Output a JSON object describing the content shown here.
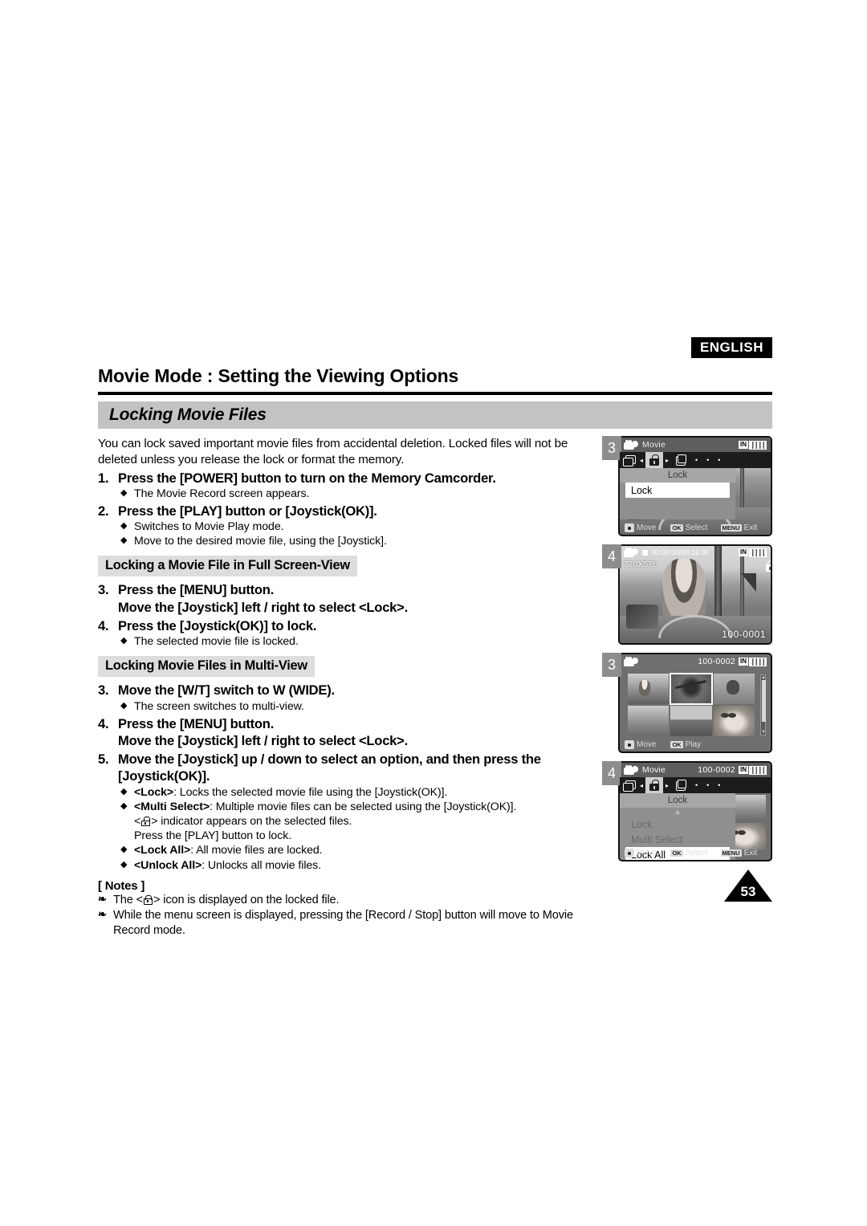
{
  "header": {
    "language_badge": "ENGLISH",
    "chapter_title": "Movie Mode : Setting the Viewing Options",
    "section_title": "Locking Movie Files"
  },
  "body": {
    "intro": "You can lock saved important movie files from accidental deletion. Locked files will not be deleted unless you release the lock or format the memory.",
    "step1_num": "1.",
    "step1_text": "Press the [POWER] button to turn on the Memory Camcorder.",
    "step1_bullet1": "The Movie Record screen appears.",
    "step2_num": "2.",
    "step2_text": "Press the [PLAY] button or [Joystick(OK)].",
    "step2_bullet1": "Switches to Movie Play mode.",
    "step2_bullet2": "Move to the desired movie file, using the [Joystick].",
    "subhead_full": "Locking a Movie File in Full Screen-View",
    "step3_num": "3.",
    "step3_text": "Press the [MENU] button.",
    "step3_text_line2": "Move the [Joystick] left / right to select <Lock>.",
    "step4_num": "4.",
    "step4_text": "Press the [Joystick(OK)] to lock.",
    "step4_bullet1": "The selected movie file is locked.",
    "subhead_multi": "Locking Movie Files in Multi-View",
    "m_step3_num": "3.",
    "m_step3_text": "Move the [W/T] switch to W (WIDE).",
    "m_step3_bullet1": "The screen switches to multi-view.",
    "m_step4_num": "4.",
    "m_step4_text": "Press the [MENU] button.",
    "m_step4_text_line2": "Move the [Joystick] left / right to select <Lock>.",
    "m_step5_num": "5.",
    "m_step5_text": "Move the [Joystick] up / down to select an option, and then press the [Joystick(OK)].",
    "opt_lock_label": "<Lock>",
    "opt_lock_desc": ": Locks the selected movie file using the [Joystick(OK)].",
    "opt_multi_label": "<Multi Select>",
    "opt_multi_desc": ": Multiple movie files can be selected using the [Joystick(OK)].",
    "opt_multi_line2_pre": "<",
    "opt_multi_line2_post": "> indicator appears on the selected files.",
    "opt_multi_line3": "Press the [PLAY] button to lock.",
    "opt_lockall_label": "<Lock All>",
    "opt_lockall_desc": ": All movie files are locked.",
    "opt_unlockall_label": "<Unlock All>",
    "opt_unlockall_desc": ": Unlocks all movie files."
  },
  "notes": {
    "heading": "[ Notes ]",
    "note1_pre": "The <",
    "note1_post": "> icon is displayed on the locked file.",
    "note2": "While the menu screen is displayed, pressing the [Record / Stop] button will move to Movie Record mode."
  },
  "screenshots": [
    {
      "step_number": "3",
      "mode_label": "Movie",
      "battery_in": "IN",
      "menu_title": "Lock",
      "menu_items": [
        "Lock"
      ],
      "hint_move": "Move",
      "hint_select_key": "OK",
      "hint_select": "Select",
      "hint_exit_key": "MENU",
      "hint_exit": "Exit"
    },
    {
      "step_number": "4",
      "timecode": "00:00:00/00:16:30",
      "battery_in": "IN",
      "resolution": "720X576",
      "file_number": "100-0001"
    },
    {
      "step_number": "3",
      "file_number": "100-0002",
      "battery_in": "IN",
      "hint_move_key": "pad",
      "hint_move": "Move",
      "hint_play_key": "OK",
      "hint_play": "Play"
    },
    {
      "step_number": "4",
      "mode_label": "Movie",
      "file_number": "100-0002",
      "battery_in": "IN",
      "menu_title": "Lock",
      "menu_items": [
        "Lock",
        "Multi Select",
        "Lock All"
      ],
      "selected_item": "Lock All",
      "hint_move": "Move",
      "hint_select_key": "OK",
      "hint_select": "Select",
      "hint_exit_key": "MENU",
      "hint_exit": "Exit"
    }
  ],
  "footer": {
    "page_number": "53"
  },
  "colors": {
    "section_bar": "#c3c3c3",
    "subhead_bg": "#dddddd",
    "lcd_bg": "#6f6f6f",
    "menu_strip": "#1c1c1c",
    "badge_bg": "#000000"
  }
}
